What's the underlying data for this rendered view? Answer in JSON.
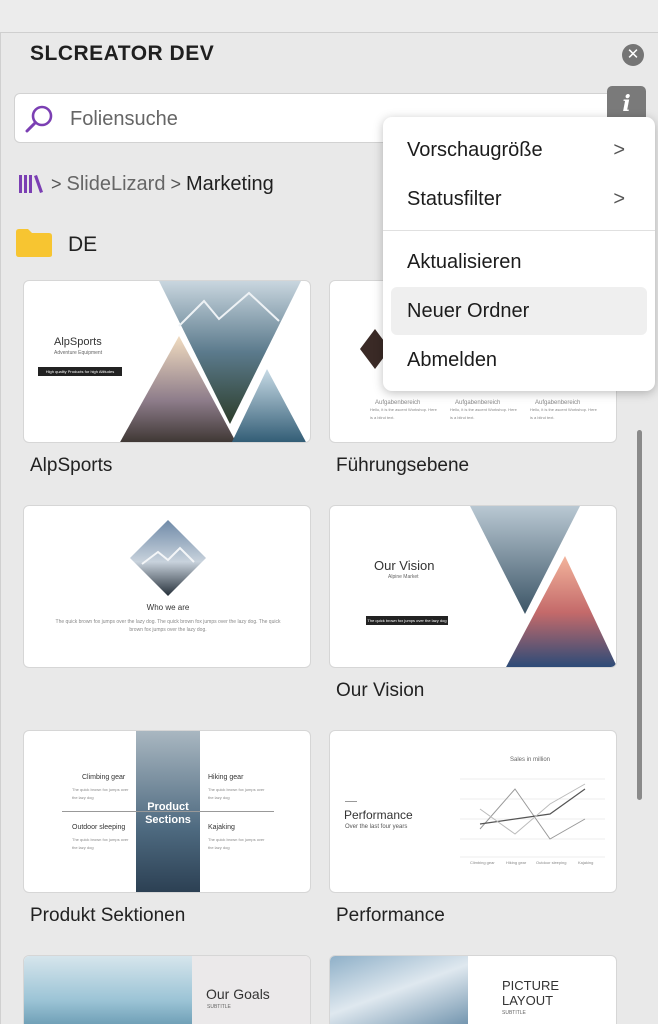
{
  "panel": {
    "title": "SLCREATOR DEV",
    "close_icon": "close-icon",
    "info_label": "i"
  },
  "search": {
    "placeholder": "Foliensuche"
  },
  "breadcrumb": {
    "root": "SlideLizard",
    "current": "Marketing"
  },
  "folder": {
    "name": "DE"
  },
  "slides": [
    {
      "label": "AlpSports",
      "title": "AlpSports",
      "subtitle": "Adventure Equipment",
      "tagline": "High quality Products for high Altitudes"
    },
    {
      "label": "Führungsebene",
      "cols": [
        "Aufgabenbereich",
        "Aufgabenbereich",
        "Aufgabenbereich"
      ],
      "body": "Hello, it is the ascent Workshop. Here is a blind text."
    },
    {
      "label": "",
      "title": "Who we are",
      "body": "The quick brown fox jumps over the lazy dog. The quick brown fox jumps over the lazy dog. The quick brown fox jumps over the lazy dog."
    },
    {
      "label": "Our Vision",
      "title": "Our Vision",
      "subtitle": "Alpine Market",
      "tagline": "The quick brown fox jumps over the lazy dog"
    },
    {
      "label": "Produkt Sektionen",
      "center": "Product Sections",
      "items": [
        "Climbing gear",
        "Hiking gear",
        "Outdoor sleeping",
        "Kajaking"
      ],
      "body": "The quick brown fox jumps over the lazy dog"
    },
    {
      "label": "Performance",
      "title": "Performance",
      "subtitle": "Over the last four years",
      "chart_title": "Sales in million",
      "x": [
        "Climbing gear",
        "Hiking gear",
        "Outdoor sleeping",
        "Kajaking"
      ]
    },
    {
      "label": "",
      "title": "Our Goals",
      "subtitle": "SUBTITLE"
    },
    {
      "label": "",
      "title": "PICTURE LAYOUT",
      "subtitle": "SUBTITLE"
    }
  ],
  "menu": {
    "items": [
      {
        "label": "Vorschaugröße",
        "submenu": true
      },
      {
        "label": "Statusfilter",
        "submenu": true
      },
      {
        "label": "Aktualisieren",
        "submenu": false
      },
      {
        "label": "Neuer Ordner",
        "submenu": false,
        "highlighted": true
      },
      {
        "label": "Abmelden",
        "submenu": false
      }
    ],
    "chevron": ">"
  },
  "colors": {
    "accent": "#7b3fb3",
    "folder": "#f7c531",
    "menu_highlight": "#efefef"
  }
}
